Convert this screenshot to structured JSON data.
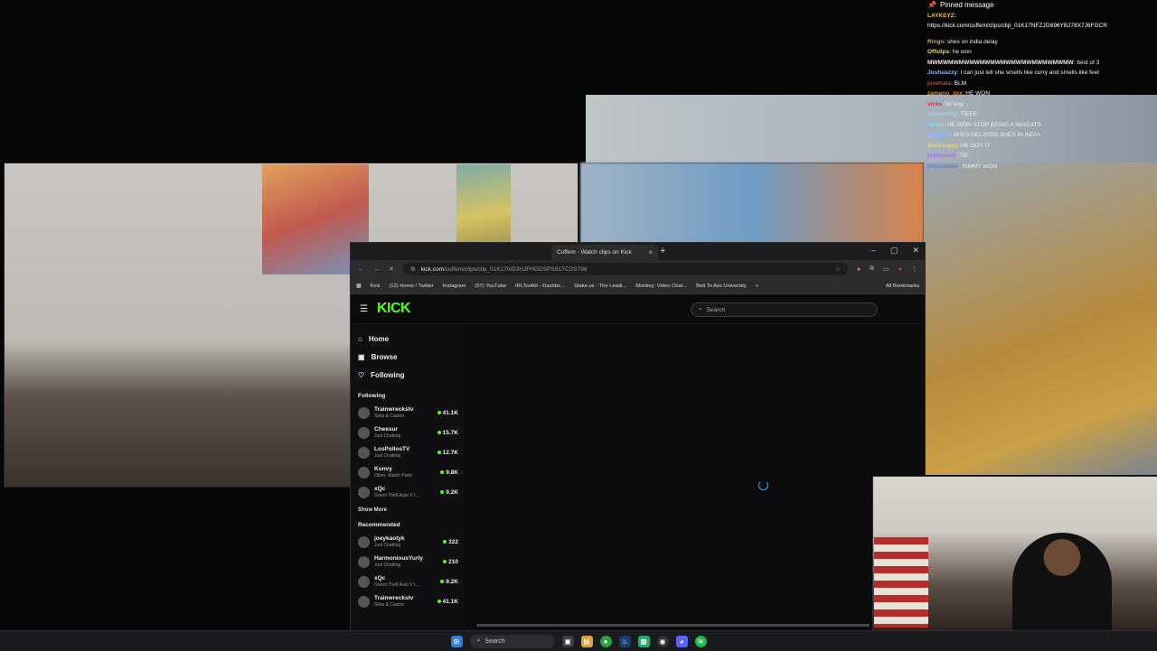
{
  "chat": {
    "pinned_label": "Pinned message",
    "pinned_author": "LAYKEYZ:",
    "pinned_url": "https://kick.com/cuffem/clips/clip_01K17NFZJG696YBJ78X7J6FGCR",
    "messages": [
      {
        "user": "Ringo",
        "text": "shes on india delay",
        "color": "#d9a441"
      },
      {
        "user": "Offslips",
        "text": "he won",
        "color": "#f1d96a"
      },
      {
        "user": "MWMWMWMWMWMWMWMWMWMWMWMWMWMW",
        "text": "best of 3",
        "color": "#e7e7e7"
      },
      {
        "user": "Joshuazzy",
        "text": "I can just tell she smells like curry and smells like feet",
        "color": "#8bbcff"
      },
      {
        "user": "jusehala",
        "text": "BLM",
        "color": "#c23f3f"
      },
      {
        "user": "zamano_xxx",
        "text": "HE WON",
        "color": "#e6862c"
      },
      {
        "user": "vicks",
        "text": "tie ong",
        "color": "#c23f3f"
      },
      {
        "user": "keinnerHQ",
        "text": "TIEEE",
        "color": "#9fd2e8"
      },
      {
        "user": "Tedlili",
        "text": "HE WON STOP BEING A NIGGATS",
        "color": "#8bd8ff"
      },
      {
        "user": "minimul",
        "text": "SHES DELAYED SHES IN INDIA",
        "color": "#8bbcff"
      },
      {
        "user": "Borlcuajay",
        "text": "HE GOT IT",
        "color": "#f1d96a"
      },
      {
        "user": "jmikeyasu",
        "text": "TIE",
        "color": "#a173e8"
      },
      {
        "user": "jthesimmer",
        "text": "SIMMY WON",
        "color": "#5b7fd8"
      }
    ]
  },
  "browser": {
    "tab_title": "Cuffem - Watch clips on Kick",
    "url_host": "kick.com",
    "url_path": "/cuffem/clips/clip_01K17NG3HJFHGDSPS81TCDS788",
    "bookmarks": [
      "Kick",
      "(12) Home / Twitter",
      "Instagram",
      "(57) YouTube",
      "IRLToolkit - Dashbo...",
      "Stake.us - The Leadi...",
      "Monkey: Video Chat...",
      "Belt To Ass University"
    ],
    "all_bookmarks": "All Bookmarks"
  },
  "site": {
    "logo": "KICK",
    "search_placeholder": "Search",
    "nav": [
      {
        "label": "Home",
        "icon": "home-icon"
      },
      {
        "label": "Browse",
        "icon": "browse-icon"
      },
      {
        "label": "Following",
        "icon": "heart-icon"
      }
    ],
    "following_heading": "Following",
    "following": [
      {
        "name": "Trainwreckstv",
        "category": "Slots & Casino",
        "viewers": "41.1K"
      },
      {
        "name": "Cheesur",
        "category": "Just Chatting",
        "viewers": "15.7K"
      },
      {
        "name": "LosPollosTV",
        "category": "Just Chatting",
        "viewers": "12.7K"
      },
      {
        "name": "Konvy",
        "category": "Other, Watch Party",
        "viewers": "9.8K"
      },
      {
        "name": "xQc",
        "category": "Grand Theft Auto V I...",
        "viewers": "9.2K"
      }
    ],
    "show_more": "Show More",
    "recommended_heading": "Recommended",
    "recommended": [
      {
        "name": "joeykaotyk",
        "category": "Just Chatting",
        "viewers": "322"
      },
      {
        "name": "HarmoniousYurly",
        "category": "Just Chatting",
        "viewers": "210"
      },
      {
        "name": "xQc",
        "category": "Grand Theft Auto V I...",
        "viewers": "9.2K"
      },
      {
        "name": "Trainwreckstv",
        "category": "Slots & Casino",
        "viewers": "41.1K"
      }
    ]
  },
  "taskbar": {
    "search_label": "Search"
  },
  "colors": {
    "kick_green": "#53fc18"
  }
}
